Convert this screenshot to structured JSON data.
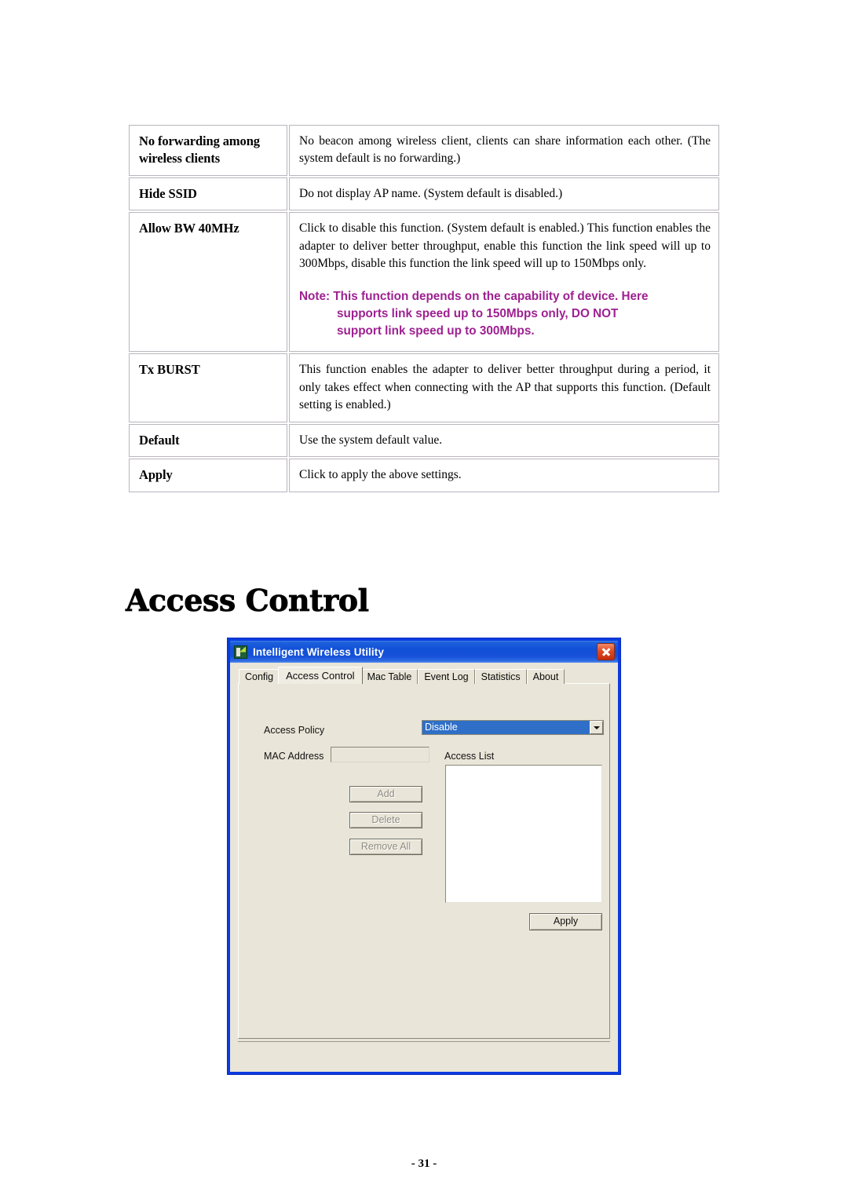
{
  "table": {
    "rows": [
      {
        "label": "No forwarding among wireless clients",
        "desc": "No beacon among wireless client, clients can share information each other. (The system default is no forwarding.)"
      },
      {
        "label": "Hide SSID",
        "desc": "Do not display AP name. (System default is disabled.)"
      },
      {
        "label": "Allow BW 40MHz",
        "desc": "Click to disable this function. (System default is enabled.) This function enables the adapter to deliver better throughput, enable this function the link speed will up to 300Mbps, disable this function the link speed will up to 150Mbps only.",
        "note_line1": "Note: This function depends on the capability of device. Here",
        "note_line2": "supports link speed up to 150Mbps only, DO NOT",
        "note_line3": "support link speed up to 300Mbps.",
        "note_color": "#9E2191"
      },
      {
        "label": "Tx BURST",
        "desc": "This function enables the adapter to deliver better throughput during a period, it only takes effect when connecting with the AP that supports this function. (Default setting is enabled.)"
      },
      {
        "label": "Default",
        "desc": "Use the system default value."
      },
      {
        "label": "Apply",
        "desc": "Click to apply the above settings."
      }
    ]
  },
  "heading": "Access Control",
  "window": {
    "title": "Intelligent Wireless Utility",
    "icon": "wireless-app-icon",
    "close_icon": "close-icon",
    "titlebar_color": "#1150D6",
    "frame_color": "#0A3BE0",
    "face_color": "#E9E5D8",
    "tabs": [
      {
        "label": "Config",
        "selected": false
      },
      {
        "label": "Access Control",
        "selected": true
      },
      {
        "label": "Mac Table",
        "selected": false
      },
      {
        "label": "Event Log",
        "selected": false
      },
      {
        "label": "Statistics",
        "selected": false
      },
      {
        "label": "About",
        "selected": false
      }
    ],
    "form": {
      "access_policy_label": "Access Policy",
      "access_policy_value": "Disable",
      "access_policy_options": [
        "Disable"
      ],
      "mac_address_label": "MAC Address",
      "mac_address_value": "",
      "access_list_label": "Access List",
      "access_list_items": [],
      "buttons": {
        "add": "Add",
        "delete": "Delete",
        "remove_all": "Remove All",
        "apply": "Apply"
      }
    }
  },
  "footer": {
    "page_number": "- 31 -"
  }
}
